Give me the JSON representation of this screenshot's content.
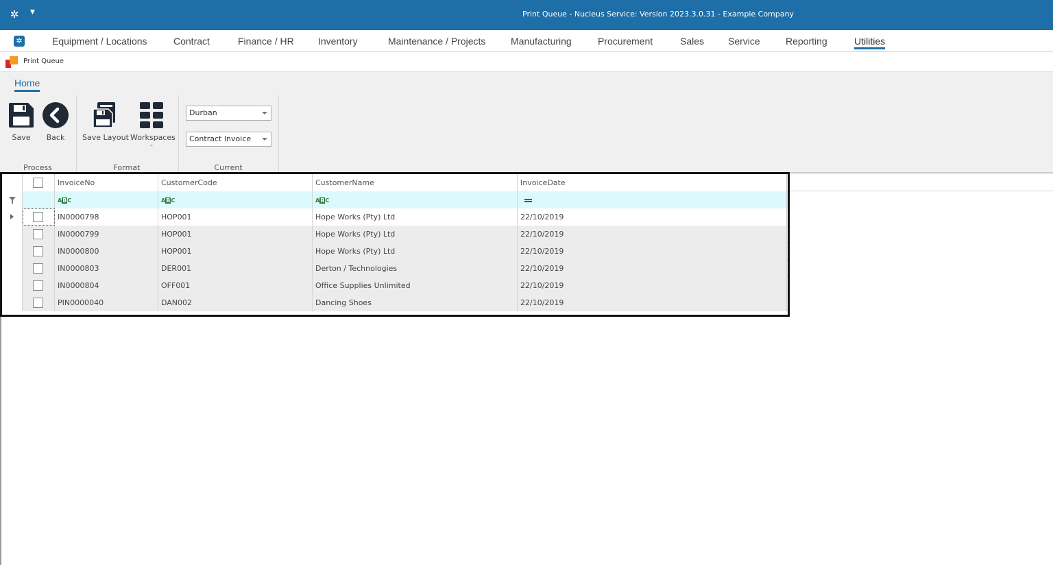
{
  "titlebar": {
    "title": "Print Queue - Nucleus Service: Version 2023.3.0.31 - Example Company",
    "app_icon": "gear-icon",
    "dropdown_icon": "caret-down-icon"
  },
  "menu": {
    "items": [
      "Equipment / Locations",
      "Contract",
      "Finance / HR",
      "Inventory",
      "Maintenance / Projects",
      "Manufacturing",
      "Procurement",
      "Sales",
      "Service",
      "Reporting",
      "Utilities"
    ],
    "active": "Utilities"
  },
  "doc_tab": {
    "label": "Print Queue"
  },
  "ribbon": {
    "tab": "Home",
    "groups": {
      "process": "Process",
      "format": "Format",
      "current": "Current"
    },
    "buttons": {
      "save": "Save",
      "back": "Back",
      "save_layout": "Save Layout",
      "workspaces": "Workspaces"
    },
    "combos": {
      "branch": "Durban",
      "report": "Contract Invoice"
    }
  },
  "grid": {
    "columns": [
      "InvoiceNo",
      "CustomerCode",
      "CustomerName",
      "InvoiceDate"
    ],
    "rows": [
      [
        "IN0000798",
        "HOP001",
        "Hope Works (Pty) Ltd",
        "22/10/2019"
      ],
      [
        "IN0000799",
        "HOP001",
        "Hope Works (Pty) Ltd",
        "22/10/2019"
      ],
      [
        "IN0000800",
        "HOP001",
        "Hope Works (Pty) Ltd",
        "22/10/2019"
      ],
      [
        "IN0000803",
        "DER001",
        "Derton / Technologies",
        "22/10/2019"
      ],
      [
        "IN0000804",
        "OFF001",
        "Office Supplies Unlimited",
        "22/10/2019"
      ],
      [
        "PIN0000040",
        "DAN002",
        "Dancing Shoes",
        "22/10/2019"
      ]
    ]
  },
  "colors": {
    "accent": "#1e6ea7",
    "filter_row": "#dcfafd",
    "row_alt": "#ececec"
  }
}
